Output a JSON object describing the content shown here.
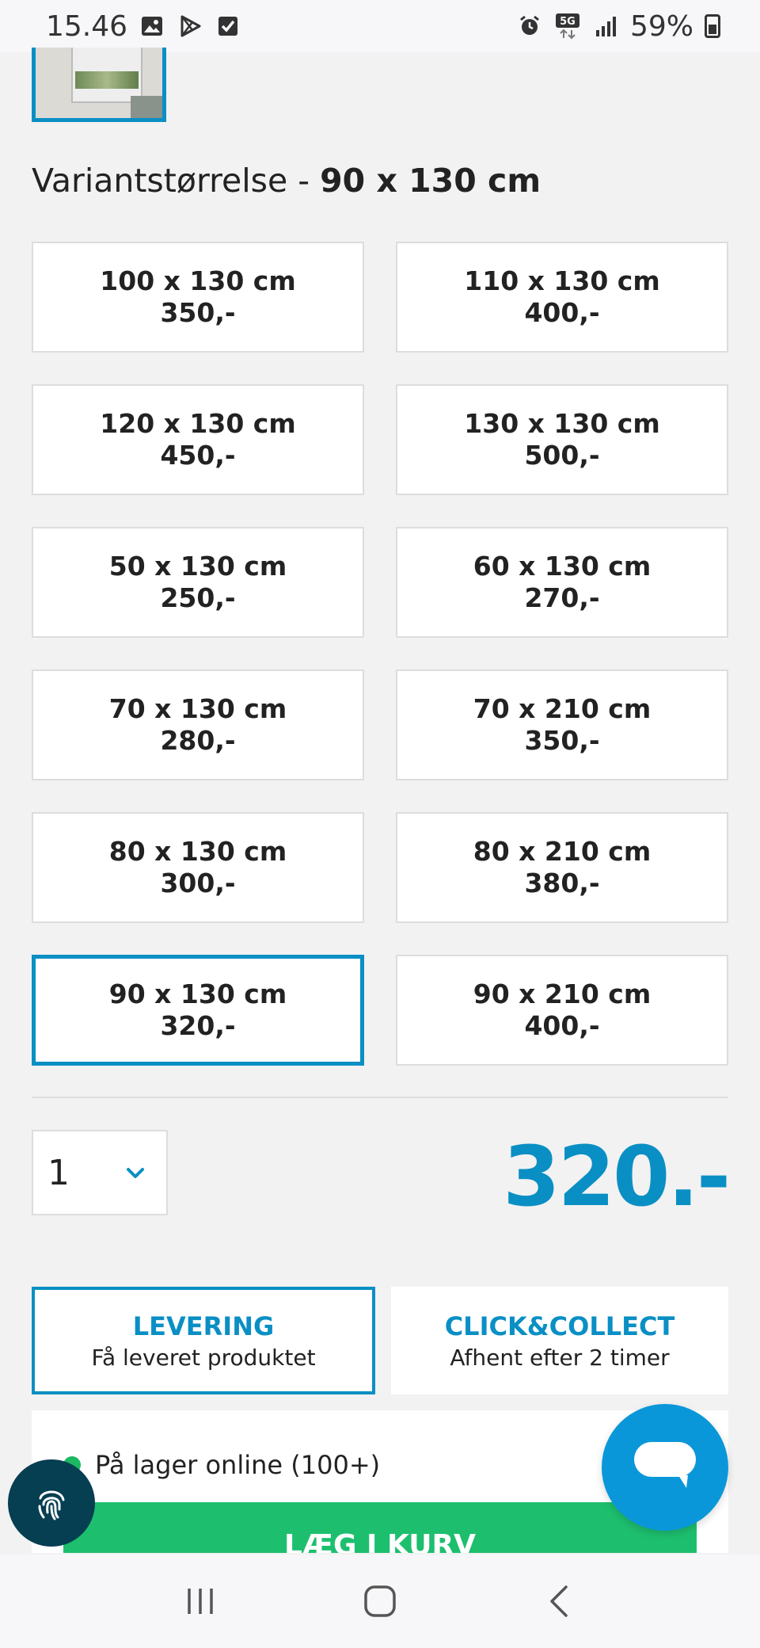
{
  "status": {
    "time": "15.46",
    "network": "5G",
    "battery": "59%",
    "left_icons": [
      "image-icon",
      "play-store-icon",
      "checkbox-icon"
    ],
    "right_icons": [
      "alarm-icon",
      "5g-icon",
      "signal-icon",
      "battery-icon"
    ]
  },
  "product": {
    "variant_label": "Variantstørrelse - ",
    "variant_selected": "90 x 130 cm"
  },
  "options": [
    {
      "size": "100 x 130 cm",
      "price": "350,-",
      "selected": false
    },
    {
      "size": "110 x 130 cm",
      "price": "400,-",
      "selected": false
    },
    {
      "size": "120 x 130 cm",
      "price": "450,-",
      "selected": false
    },
    {
      "size": "130 x 130 cm",
      "price": "500,-",
      "selected": false
    },
    {
      "size": "50 x 130 cm",
      "price": "250,-",
      "selected": false
    },
    {
      "size": "60 x 130 cm",
      "price": "270,-",
      "selected": false
    },
    {
      "size": "70 x 130 cm",
      "price": "280,-",
      "selected": false
    },
    {
      "size": "70 x 210 cm",
      "price": "350,-",
      "selected": false
    },
    {
      "size": "80 x 130 cm",
      "price": "300,-",
      "selected": false
    },
    {
      "size": "80 x 210 cm",
      "price": "380,-",
      "selected": false
    },
    {
      "size": "90 x 130 cm",
      "price": "320,-",
      "selected": true
    },
    {
      "size": "90 x 210 cm",
      "price": "400,-",
      "selected": false
    }
  ],
  "quantity": "1",
  "price": "320.-",
  "tabs": [
    {
      "title": "LEVERING",
      "subtitle": "Få leveret produktet",
      "active": true
    },
    {
      "title": "CLICK&COLLECT",
      "subtitle": "Afhent efter 2 timer",
      "active": false
    }
  ],
  "stock": {
    "text": "På lager online (100+)",
    "cart_button": "LÆG I KURV"
  },
  "colors": {
    "accent": "#0a8fc4",
    "stock_green": "#1db862",
    "cart_green": "#1dbf6e",
    "fingerprint_bg": "#063e52",
    "chat_bg": "#0a97d9"
  }
}
